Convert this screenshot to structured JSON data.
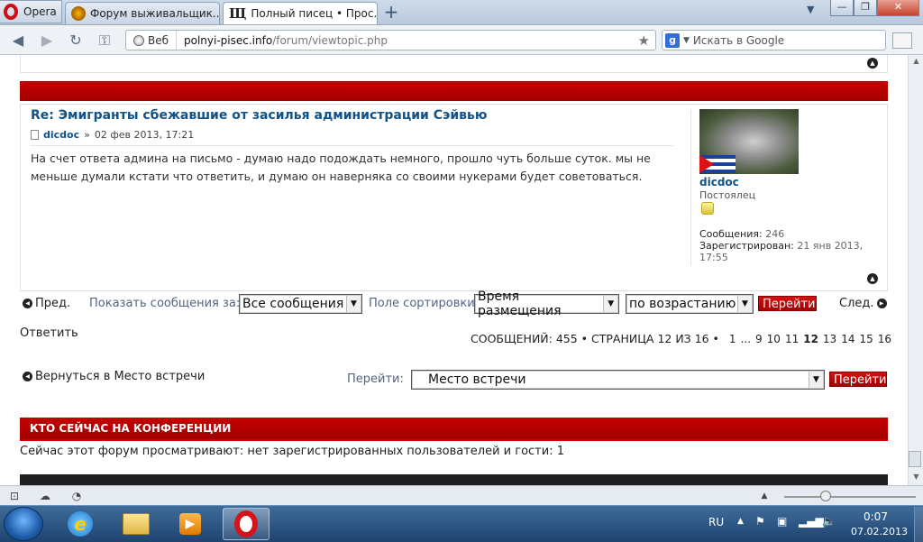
{
  "browser": {
    "app_name": "Opera",
    "tabs": [
      {
        "title": "Форум выживальщик...",
        "active": false
      },
      {
        "title": "Полный писец • Прос...",
        "active": true
      }
    ],
    "window_controls": {
      "minimize": "—",
      "restore": "❐",
      "close": "✕"
    },
    "address": {
      "badge": "Веб",
      "host": "polnyi-pisec.info",
      "path": "/forum/viewtopic.php"
    },
    "search": {
      "placeholder": "Искать в Google",
      "engine_icon": "g-icon"
    },
    "nav_icons": [
      "back-icon",
      "forward-icon",
      "reload-icon",
      "key-icon"
    ]
  },
  "post": {
    "title": "Re: Эмигранты сбежавшие от засилья администрации Сэйвью",
    "author": "dicdoc",
    "separator": "»",
    "date": "02 фев 2013, 17:21",
    "body": "На счет ответа админа на письмо - думаю надо подождать немного, прошло чуть больше суток. мы не меньше думали кстати что ответить, и думаю он наверняка со своими нукерами будет советоваться."
  },
  "profile": {
    "name": "dicdoc",
    "rank": "Постоялец",
    "posts_label": "Сообщения:",
    "posts_value": "246",
    "registered_label": "Зарегистрирован:",
    "registered_value": "21 янв 2013, 17:55"
  },
  "controls": {
    "prev": "Пред.",
    "show_label": "Показать сообщения за:",
    "show_value": "Все сообщения",
    "sort_label": "Поле сортировки",
    "sort_value": "Время размещения",
    "order_value": "по возрастанию",
    "go": "Перейти",
    "next": "След."
  },
  "pagination": {
    "reply": "Ответить",
    "summary": "СООБЩЕНИЙ: 455 • СТРАНИЦА 12 ИЗ 16 •",
    "pages": [
      "1",
      "...",
      "9",
      "10",
      "11",
      "12",
      "13",
      "14",
      "15",
      "16"
    ],
    "current": "12"
  },
  "jump": {
    "back_link": "Вернуться в Место встречи",
    "label": "Перейти:",
    "value": "Место встречи",
    "button": "Перейти"
  },
  "online": {
    "heading": "КТО СЕЙЧАС НА КОНФЕРЕНЦИИ",
    "text": "Сейчас этот форум просматривают: нет зарегистрированных пользователей и гости: 1"
  },
  "taskbar": {
    "language": "RU",
    "time": "0:07",
    "date": "07.02.2013"
  }
}
